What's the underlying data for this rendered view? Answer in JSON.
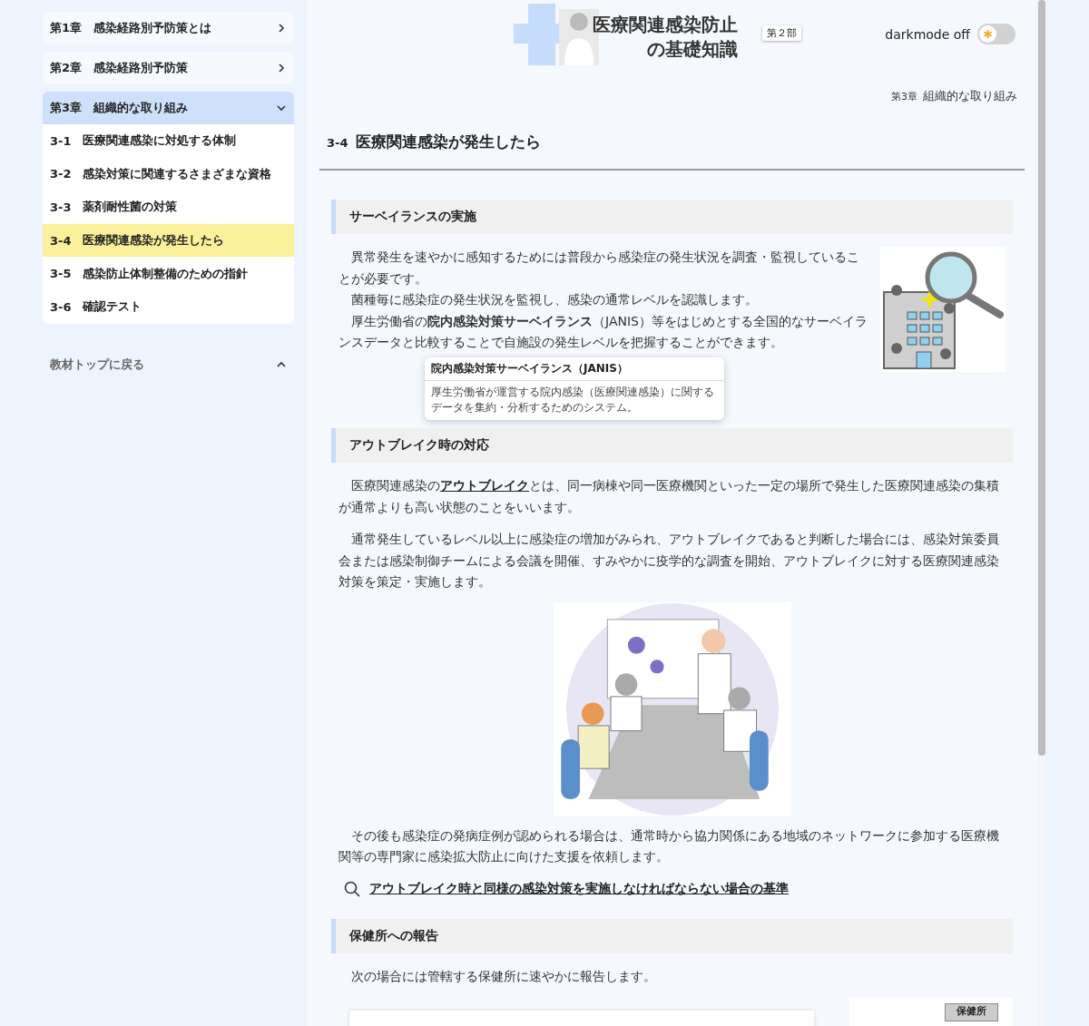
{
  "sidebar": {
    "chapters": [
      {
        "label": "第1章　感染経路別予防策とは",
        "expanded": false
      },
      {
        "label": "第2章　感染経路別予防策",
        "expanded": false
      },
      {
        "label": "第3章　組織的な取り組み",
        "expanded": true,
        "items": [
          {
            "number": "3-1",
            "label": "医療関連感染に対処する体制",
            "selected": false
          },
          {
            "number": "3-2",
            "label": "感染対策に関連するさまざまな資格",
            "selected": false
          },
          {
            "number": "3-3",
            "label": "薬剤耐性菌の対策",
            "selected": false
          },
          {
            "number": "3-4",
            "label": "医療関連感染が発生したら",
            "selected": true
          },
          {
            "number": "3-5",
            "label": "感染防止体制整備のための指針",
            "selected": false
          },
          {
            "number": "3-6",
            "label": "確認テスト",
            "selected": false
          }
        ]
      }
    ],
    "back_link": "教材トップに戻る"
  },
  "header": {
    "logo": {
      "line1": "医療関連感染防止",
      "line2": "の基礎知識",
      "badge": "第２部"
    },
    "darkmode": {
      "label": "darkmode off",
      "on": false
    }
  },
  "breadcrumb": {
    "chapter": "第3章",
    "title": "組織的な取り組み"
  },
  "page_title": {
    "number": "3-4",
    "text": "医療関連感染が発生したら"
  },
  "sections": [
    {
      "heading": "サーベイランスの実施",
      "paragraphs": [
        "異常発生を速やかに感知するためには普段から感染症の発生状況を調査・監視していることが必要です。",
        "菌種毎に感染症の発生状況を監視し、感染の通常レベルを認識します。",
        "厚生労働省の**院内感染対策サーベイランス**（JANIS）等をはじめとする全国的なサーベイランスデータと比較することで自施設の発生レベルを把握することができます。"
      ],
      "tooltip": {
        "title": "院内感染対策サーベイランス（JANIS）",
        "body": "厚生労働省が運営する院内感染（医療関連感染）に関するデータを集約・分析するためのシステム。"
      }
    },
    {
      "heading": "アウトブレイク時の対応",
      "intro": {
        "before": "医療関連感染の",
        "link": "アウトブレイク",
        "after": "とは、同一病棟や同一医療機関といった一定の場所で発生した医療関連感染の集積が通常よりも高い状態のことをいいます。"
      },
      "paragraphs": [
        "通常発生しているレベル以上に感染症の増加がみられ、アウトブレイクであると判断した場合には、感染対策委員会または感染制御チームによる会議を開催、すみやかに疫学的な調査を開始、アウトブレイクに対する医療関連感染対策を策定・実施します。"
      ],
      "after": "その後も感染症の発病症例が認められる場合は、通常時から協力関係にある地域のネットワークに参加する医療機関等の専門家に感染拡大防止に向けた支援を依頼します。",
      "search_link": "アウトブレイク時と同様の感染対策を実施しなければならない場合の基準"
    },
    {
      "heading": "保健所への報告",
      "paragraphs": [
        "次の場合には管轄する保健所に速やかに報告します。"
      ],
      "figure_label": "保健所"
    }
  ]
}
